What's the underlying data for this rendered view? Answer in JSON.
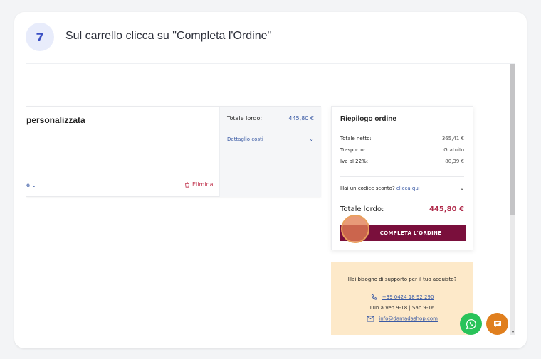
{
  "step": {
    "number": "7",
    "title": "Sul carrello clicca su \"Completa l'Ordine\""
  },
  "product": {
    "title": "personalizzata",
    "dropdown_label": "e",
    "delete_label": "Elimina"
  },
  "costs": {
    "total_label": "Totale lordo:",
    "total_value": "445,80 €",
    "details_label": "Dettaglio costi"
  },
  "summary": {
    "title": "Riepilogo ordine",
    "rows": [
      {
        "label": "Totale netto:",
        "value": "365,41 €"
      },
      {
        "label": "Trasporto:",
        "value": "Gratuito"
      },
      {
        "label": "Iva al 22%:",
        "value": "80,39 €"
      }
    ],
    "discount_prompt": "Hai un codice sconto?",
    "discount_link": "clicca qui",
    "total_label": "Totale lordo:",
    "total_value": "445,80 €",
    "checkout_button": "COMPLETA L'ORDINE"
  },
  "support": {
    "title": "Hai bisogno di supporto per il tuo acquisto?",
    "phone": "+39 0424 18 92 290",
    "hours": "Lun a Ven 9-18 | Sab 9-16",
    "email": "info@damadashop.com"
  },
  "colors": {
    "brand": "#7a0f3c",
    "accent_price": "#b02a4a",
    "link": "#3b5ba5",
    "support_bg": "#fde9c9",
    "whatsapp": "#29c35a",
    "chat": "#e07f1e"
  },
  "icons": [
    "trash-icon",
    "chevron-down-icon",
    "phone-icon",
    "mail-icon",
    "whatsapp-icon",
    "chat-icon",
    "click-indicator"
  ]
}
